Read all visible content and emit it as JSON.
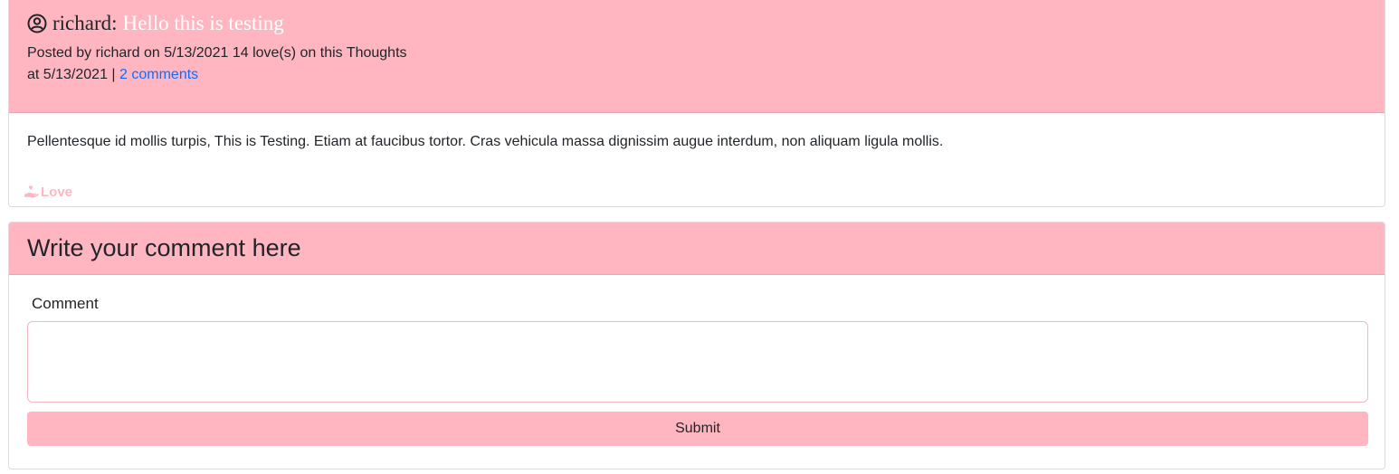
{
  "thought": {
    "username": "richard:",
    "title": "Hello this is testing",
    "meta_posted": "Posted by richard on 5/13/2021 14 love(s) on this Thoughts",
    "meta_at": "at 5/13/2021 | ",
    "comments_link": "2 comments",
    "body": "Pellentesque id mollis turpis, This is Testing. Etiam at faucibus tortor. Cras vehicula massa dignissim augue interdum, non aliquam ligula mollis.",
    "love_label": "Love"
  },
  "comment_form": {
    "heading": "Write your comment here",
    "label": "Comment",
    "input_value": "",
    "submit_label": "Submit"
  },
  "colors": {
    "accent": "#ffb6c1",
    "link": "#0d6efd"
  },
  "icons": {
    "user": "user-circle-icon",
    "love": "hand-heart-icon"
  }
}
